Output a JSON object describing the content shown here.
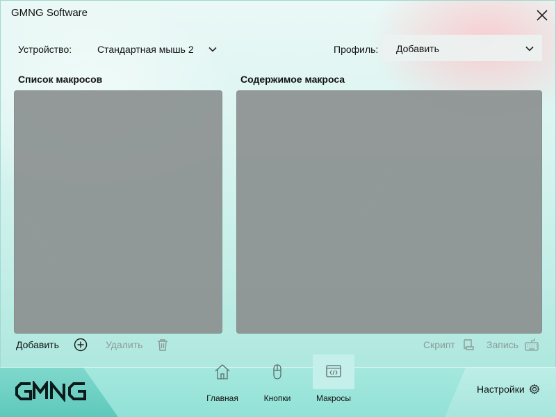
{
  "app": {
    "title": "GMNG Software"
  },
  "device": {
    "label": "Устройство:",
    "value": "Стандартная мышь 2"
  },
  "profile": {
    "label": "Профиль:",
    "value": "Добавить"
  },
  "macro_list": {
    "heading": "Список макросов"
  },
  "macro_content": {
    "heading": "Содержимое макроса"
  },
  "actions": {
    "add": "Добавить",
    "delete": "Удалить",
    "script": "Скрипт",
    "record": "Запись"
  },
  "nav": [
    {
      "label": "Главная",
      "icon": "home-icon"
    },
    {
      "label": "Кнопки",
      "icon": "mouse-icon"
    },
    {
      "label": "Макросы",
      "icon": "code-icon",
      "active": true
    }
  ],
  "settings": {
    "label": "Настройки"
  },
  "logo_text": "GMNG",
  "colors": {
    "panel": "#8c9191",
    "accent_teal": "#5ec9bb",
    "disabled_text": "#8a9a98"
  }
}
